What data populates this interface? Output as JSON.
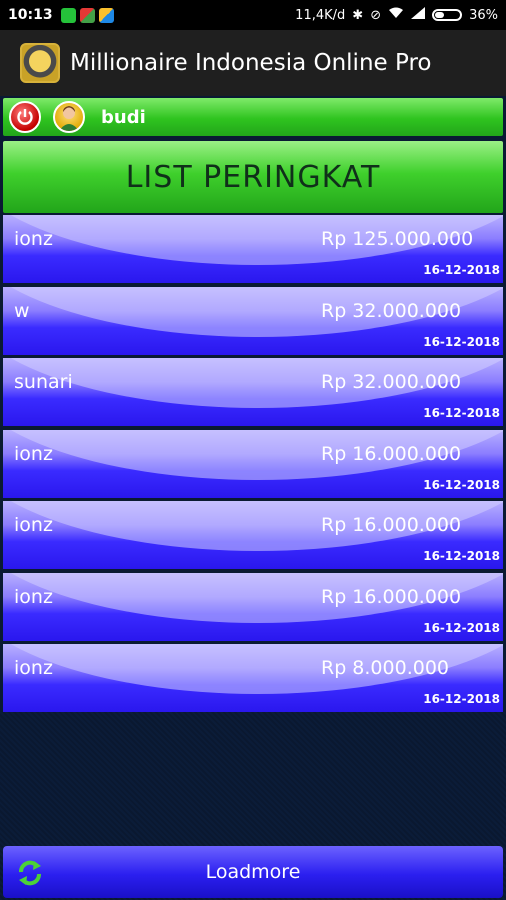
{
  "status_bar": {
    "time": "10:13",
    "network_speed": "11,4K/d",
    "battery": "36%",
    "icons": [
      "whatsapp-icon",
      "app-icon",
      "app-icon",
      "bluetooth-icon",
      "silent-icon",
      "wifi-icon",
      "signal-icon",
      "battery-icon"
    ]
  },
  "app_bar": {
    "title": "Millionaire Indonesia Online Pro"
  },
  "user_bar": {
    "username": "budi"
  },
  "header": {
    "title": "LIST PERINGKAT"
  },
  "rankings": [
    {
      "name": "ionz",
      "amount": "Rp 125.000.000",
      "date": "16-12-2018"
    },
    {
      "name": "w",
      "amount": "Rp 32.000.000",
      "date": "16-12-2018"
    },
    {
      "name": "sunari",
      "amount": "Rp 32.000.000",
      "date": "16-12-2018"
    },
    {
      "name": "ionz",
      "amount": "Rp 16.000.000",
      "date": "16-12-2018"
    },
    {
      "name": "ionz",
      "amount": "Rp 16.000.000",
      "date": "16-12-2018"
    },
    {
      "name": "ionz",
      "amount": "Rp 16.000.000",
      "date": "16-12-2018"
    },
    {
      "name": "ionz",
      "amount": "Rp 8.000.000",
      "date": "16-12-2018"
    }
  ],
  "footer": {
    "load_more_label": "Loadmore"
  },
  "colors": {
    "green_accent": "#2fc41f",
    "row_blue": "#2a17ee",
    "background": "#0a1a33"
  }
}
